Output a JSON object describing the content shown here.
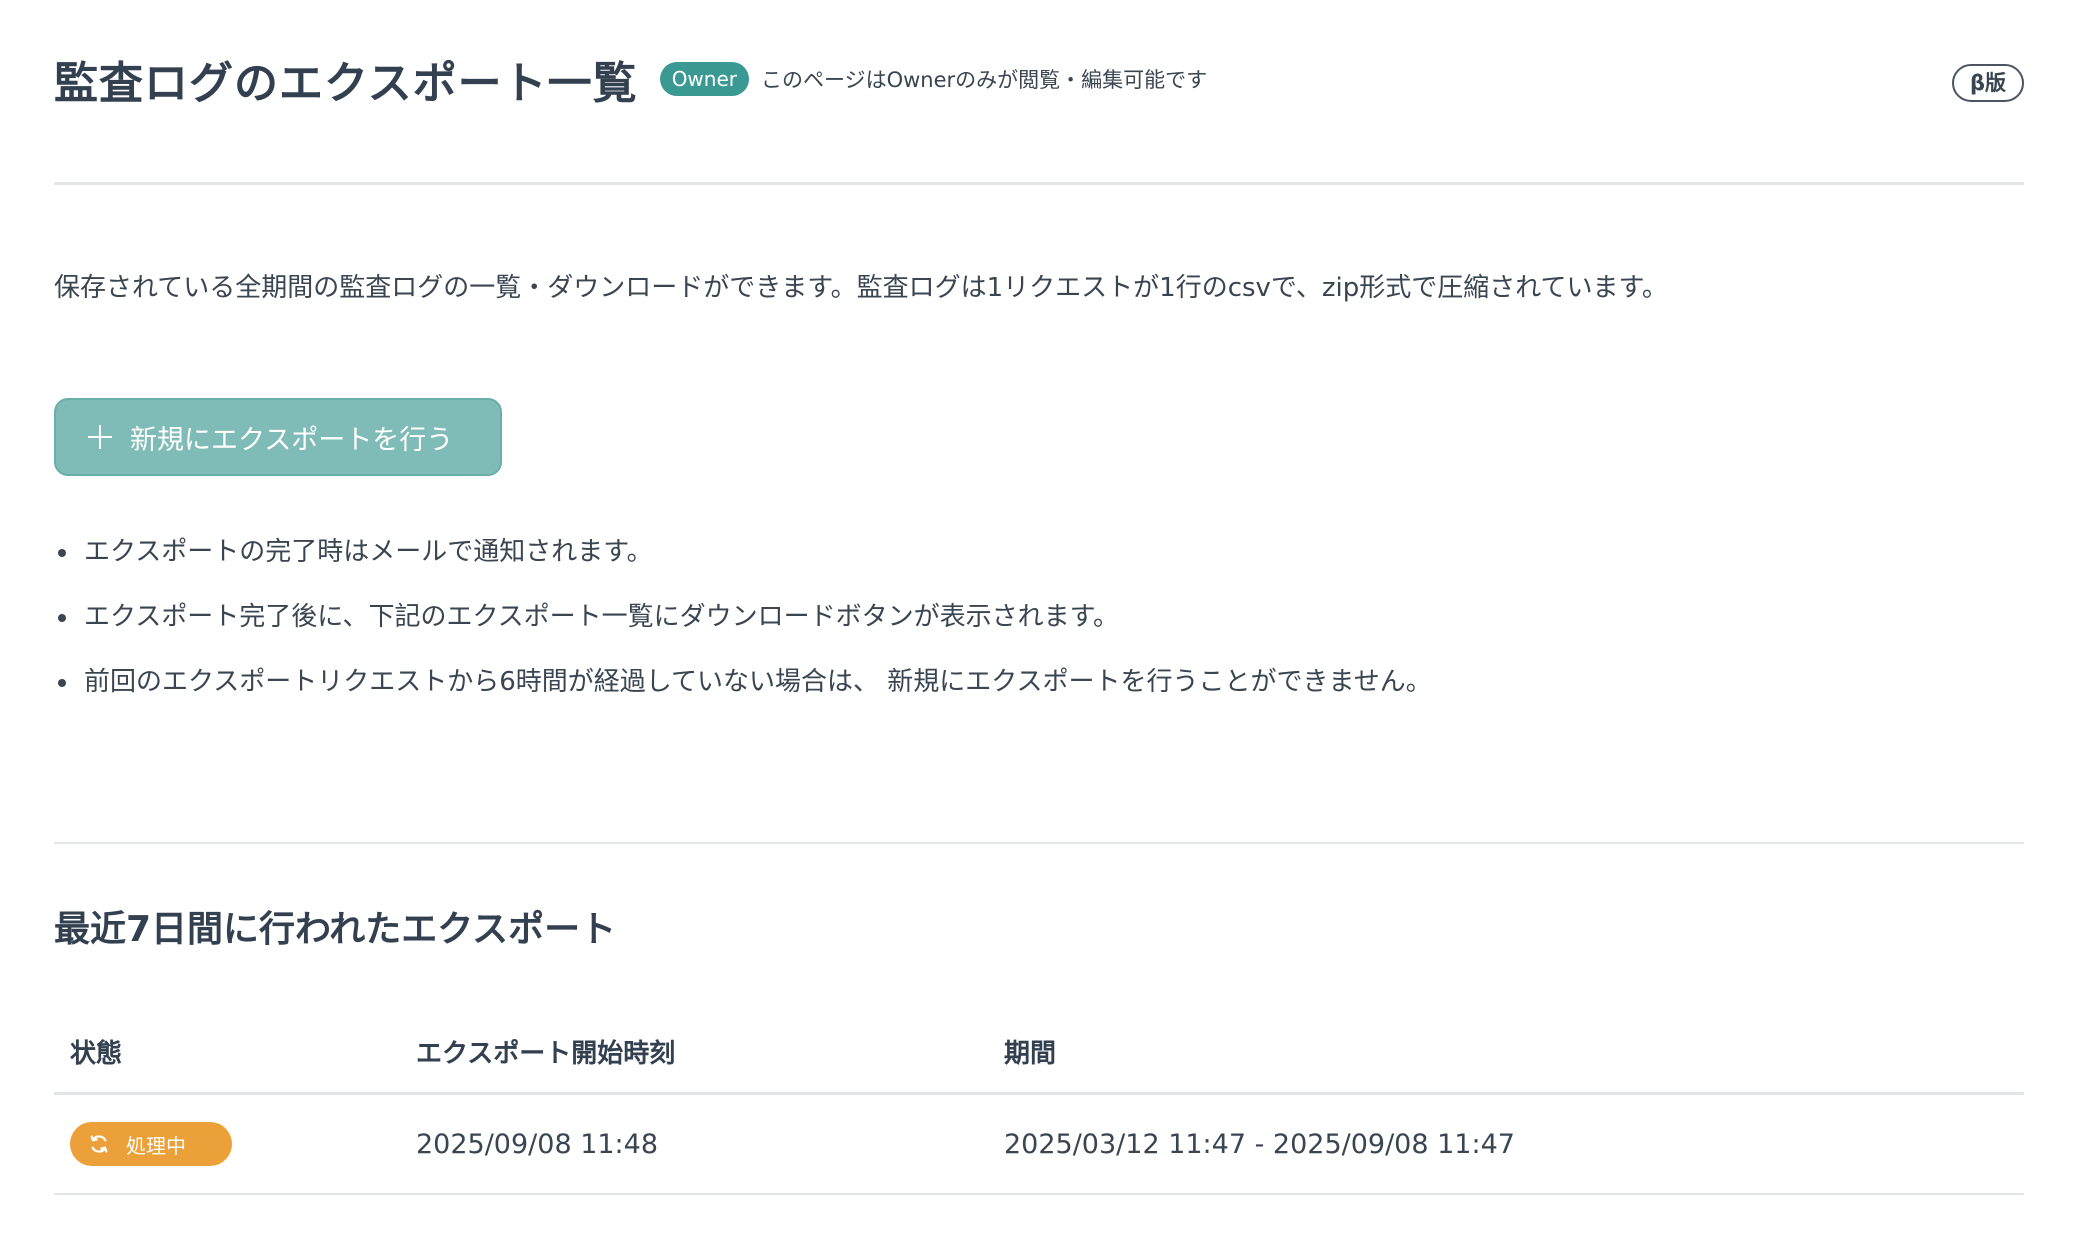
{
  "header": {
    "title": "監査ログのエクスポート一覧",
    "role_badge": "Owner",
    "role_note": "このページはOwnerのみが閲覧・編集可能です",
    "beta_badge": "β版"
  },
  "description": "保存されている全期間の監査ログの一覧・ダウンロードができます。監査ログは1リクエストが1行のcsvで、zip形式で圧縮されています。",
  "export_button": {
    "label": "新規にエクスポートを行う",
    "icon": "plus-icon"
  },
  "notes": [
    "エクスポートの完了時はメールで通知されます。",
    "エクスポート完了後に、下記のエクスポート一覧にダウンロードボタンが表示されます。",
    "前回のエクスポートリクエストから6時間が経過していない場合は、 新規にエクスポートを行うことができません。"
  ],
  "recent_section": {
    "title": "最近7日間に行われたエクスポート",
    "columns": [
      "状態",
      "エクスポート開始時刻",
      "期間"
    ],
    "rows": [
      {
        "status": "処理中",
        "status_icon": "refresh-icon",
        "started_at": "2025/09/08 11:48",
        "period": "2025/03/12 11:47 - 2025/09/08 11:47"
      }
    ]
  },
  "colors": {
    "accent": "#3a9a93",
    "button_disabled": "#7fbbb7",
    "status_processing": "#eba03a",
    "text": "#3a4552"
  }
}
